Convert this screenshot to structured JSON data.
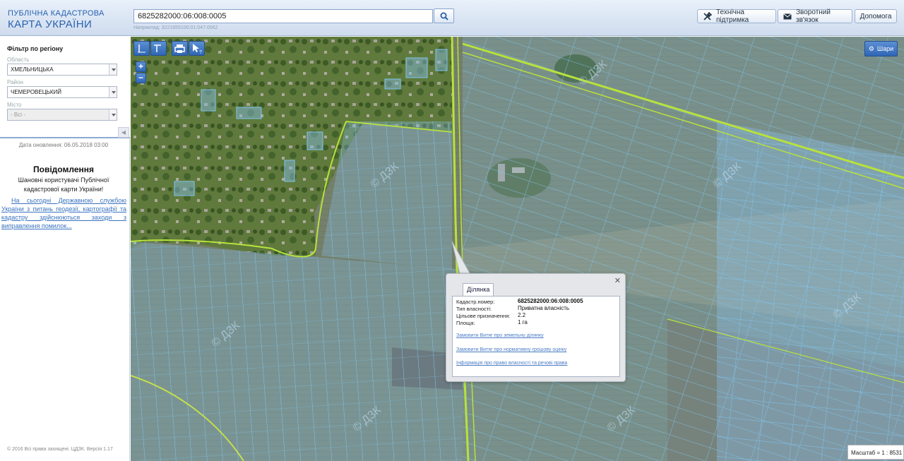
{
  "header": {
    "logo_line1": "ПУБЛІЧНА КАДАСТРОВА",
    "logo_line2": "КАРТА УКРАЇНИ",
    "search_value": "6825282000:06:008:0005",
    "search_hint": "Наприклад: 3221655100:01:047:0062",
    "buttons": {
      "support": "Технічна підтримка",
      "feedback": "Зворотний зв'язок",
      "help": "Допомога"
    }
  },
  "sidebar": {
    "filter_title": "Фільтр по регіону",
    "oblast_label": "Область",
    "oblast_value": "ХМЕЛЬНИЦЬКА",
    "rayon_label": "Район",
    "rayon_value": "ЧЕМЕРОВЕЦЬКИЙ",
    "city_label": "Місто",
    "city_value": "- Всі -",
    "updated": "Дата оновлення: 06.05.2018 03:00",
    "notice_title": "Повідомлення",
    "notice_text": "Шановні користувачі Публічної кадастрової карти України!",
    "notice_link": "На сьогодні Державною службою України з питань геодезії, картографії та кадастру здійснюються заходи з виправлення помилок...",
    "copyright": "© 2016 Всі права захищені. ЦДЗК. Версія 1.17"
  },
  "map": {
    "layers_label": "Шари",
    "scale_text": "Масштаб = 1 : 8531",
    "watermark": "© ДЗК",
    "popup": {
      "tab": "Ділянка",
      "rows": [
        {
          "label": "Кадастр.номер:",
          "value": "6825282000:06:008:0005"
        },
        {
          "label": "Тип власності:",
          "value": "Приватна власність"
        },
        {
          "label": "Цільове призначення:",
          "value": "2.2"
        },
        {
          "label": "Площа:",
          "value": "1 га"
        }
      ],
      "links": [
        "Замовити Витяг про земельну ділянку",
        "Замовити Витяг про нормативну грошову оцінку",
        "Інформація про право власності та речові права"
      ]
    }
  },
  "colors": {
    "parcel_stroke": "#7fc4ee",
    "road_line": "#b8e23c",
    "accent_blue": "#2f66b6"
  }
}
